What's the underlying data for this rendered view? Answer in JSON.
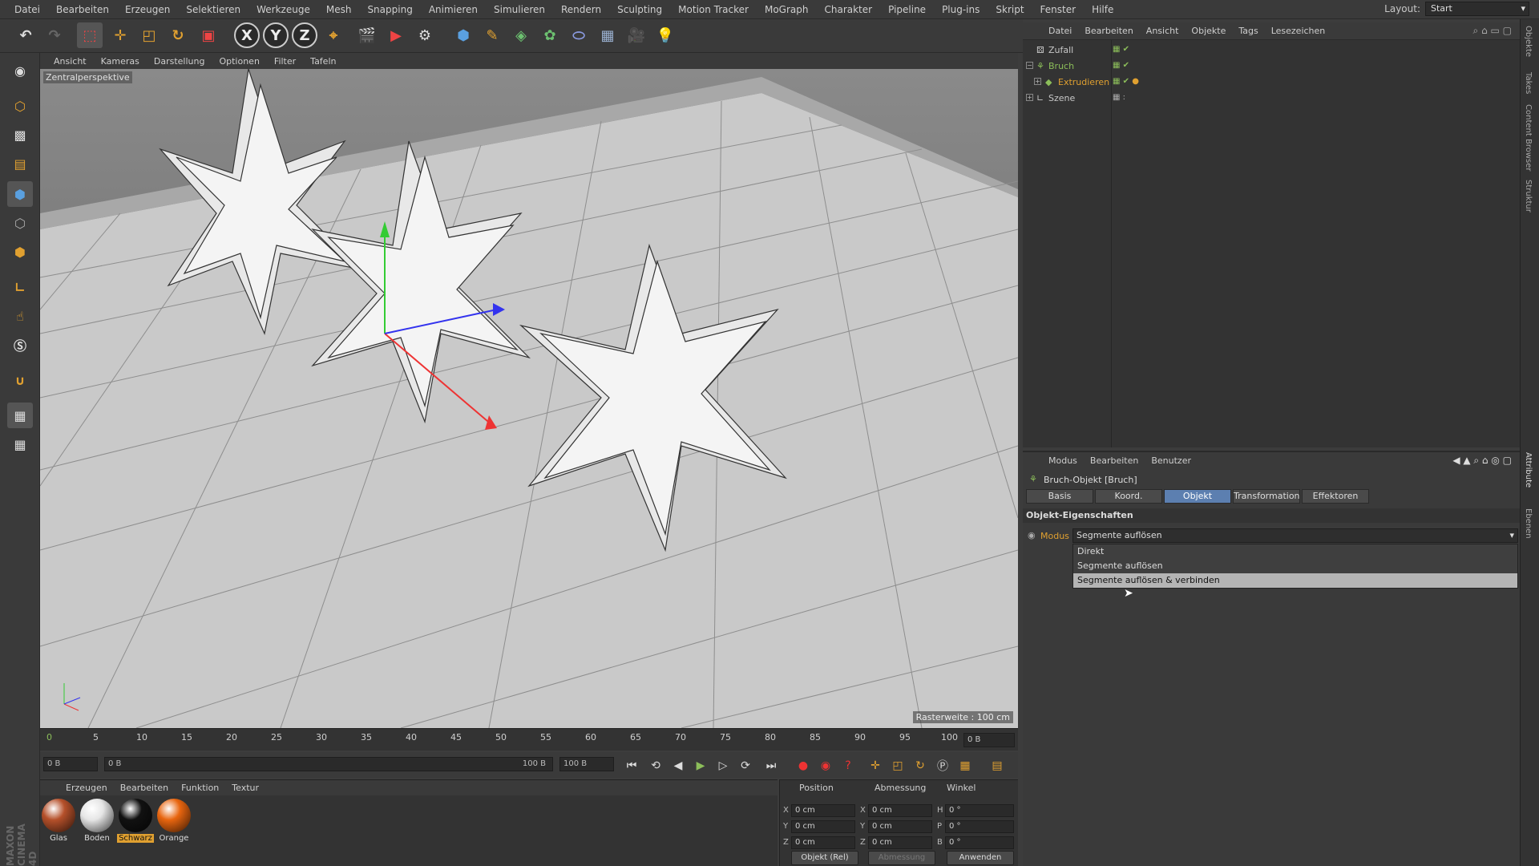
{
  "menubar": {
    "items": [
      "Datei",
      "Bearbeiten",
      "Erzeugen",
      "Selektieren",
      "Werkzeuge",
      "Mesh",
      "Snapping",
      "Animieren",
      "Simulieren",
      "Rendern",
      "Sculpting",
      "Motion Tracker",
      "MoGraph",
      "Charakter",
      "Pipeline",
      "Plug-ins",
      "Skript",
      "Fenster",
      "Hilfe"
    ],
    "layout_label": "Layout:",
    "layout_value": "Start"
  },
  "toolbar": {
    "x_label": "X",
    "y_label": "Y",
    "z_label": "Z",
    "icons": [
      "undo-icon",
      "redo-icon",
      "live-select-icon",
      "move-icon",
      "scale-icon",
      "rotate-icon",
      "recent-tools-icon",
      "lock-x-icon",
      "lock-y-icon",
      "lock-z-icon",
      "coordinate-system-icon",
      "render-view-icon",
      "render-picture-viewer-icon",
      "render-settings-icon",
      "cube-icon",
      "pen-icon",
      "subdivision-icon",
      "cloner-icon",
      "deformer-icon",
      "floor-icon",
      "camera-icon",
      "light-icon"
    ]
  },
  "viewport": {
    "menu": [
      "Ansicht",
      "Kameras",
      "Darstellung",
      "Optionen",
      "Filter",
      "Tafeln"
    ],
    "perspective_label": "Zentralperspektive",
    "grid_label": "Rasterweite : 100 cm"
  },
  "timeline": {
    "ticks": [
      "0",
      "5",
      "10",
      "15",
      "20",
      "25",
      "30",
      "35",
      "40",
      "45",
      "50",
      "55",
      "60",
      "65",
      "70",
      "75",
      "80",
      "85",
      "90",
      "95",
      "100"
    ],
    "current_frame": "0 B"
  },
  "transport": {
    "start_field": "0 B",
    "range_start": "0 B",
    "range_end": "100 B",
    "end_field": "100 B"
  },
  "materials": {
    "menu": [
      "Erzeugen",
      "Bearbeiten",
      "Funktion",
      "Textur"
    ],
    "items": [
      {
        "label": "Glas",
        "color": "#b5502a"
      },
      {
        "label": "Boden",
        "color": "#e6e6e6"
      },
      {
        "label": "Schwarz",
        "color": "#111111"
      },
      {
        "label": "Orange",
        "color": "#e8650f"
      }
    ],
    "selected_index": 2,
    "selected_bg": "#e0a030"
  },
  "coords": {
    "headers": {
      "position": "Position",
      "size": "Abmessung",
      "rotation": "Winkel"
    },
    "rows": [
      {
        "axis": "X",
        "pos": "0 cm",
        "size_axis": "X",
        "size": "0 cm",
        "rot_axis": "H",
        "rot": "0 °"
      },
      {
        "axis": "Y",
        "pos": "0 cm",
        "size_axis": "Y",
        "size": "0 cm",
        "rot_axis": "P",
        "rot": "0 °"
      },
      {
        "axis": "Z",
        "pos": "0 cm",
        "size_axis": "Z",
        "size": "0 cm",
        "rot_axis": "B",
        "rot": "0 °"
      }
    ],
    "mode_select": "Objekt (Rel)",
    "size_select": "Abmessung",
    "apply_button": "Anwenden"
  },
  "object_manager": {
    "menu": [
      "Datei",
      "Bearbeiten",
      "Ansicht",
      "Objekte",
      "Tags",
      "Lesezeichen"
    ],
    "objects": [
      {
        "name": "Zufall",
        "color": "#c8c8c8",
        "indent": 0,
        "expander": ""
      },
      {
        "name": "Bruch",
        "color": "#8cbe5a",
        "indent": 0,
        "expander": "−"
      },
      {
        "name": "Extrudieren",
        "color": "#e0a030",
        "indent": 1,
        "expander": "+"
      },
      {
        "name": "Szene",
        "color": "#c8c8c8",
        "indent": 0,
        "expander": "+"
      }
    ]
  },
  "attribute_manager": {
    "menu": [
      "Modus",
      "Bearbeiten",
      "Benutzer"
    ],
    "title": "Bruch-Objekt [Bruch]",
    "tabs": [
      "Basis",
      "Koord.",
      "Objekt",
      "Transformation",
      "Effektoren"
    ],
    "active_tab": "Objekt",
    "section": "Objekt-Eigenschaften",
    "modus_label": "Modus",
    "modus_value": "Segmente auflösen",
    "dropdown_options": [
      "Direkt",
      "Segmente auflösen",
      "Segmente auflösen & verbinden"
    ],
    "highlighted_option": "Segmente auflösen & verbinden"
  },
  "side_tabs": [
    "Objekte",
    "Takes",
    "Content Browser",
    "Struktur",
    "Attribute",
    "Ebenen"
  ],
  "brand": "MAXON CINEMA 4D",
  "colors": {
    "accent": "#5c7fb0",
    "highlight": "#e0a030",
    "green": "#8cbe5a"
  }
}
